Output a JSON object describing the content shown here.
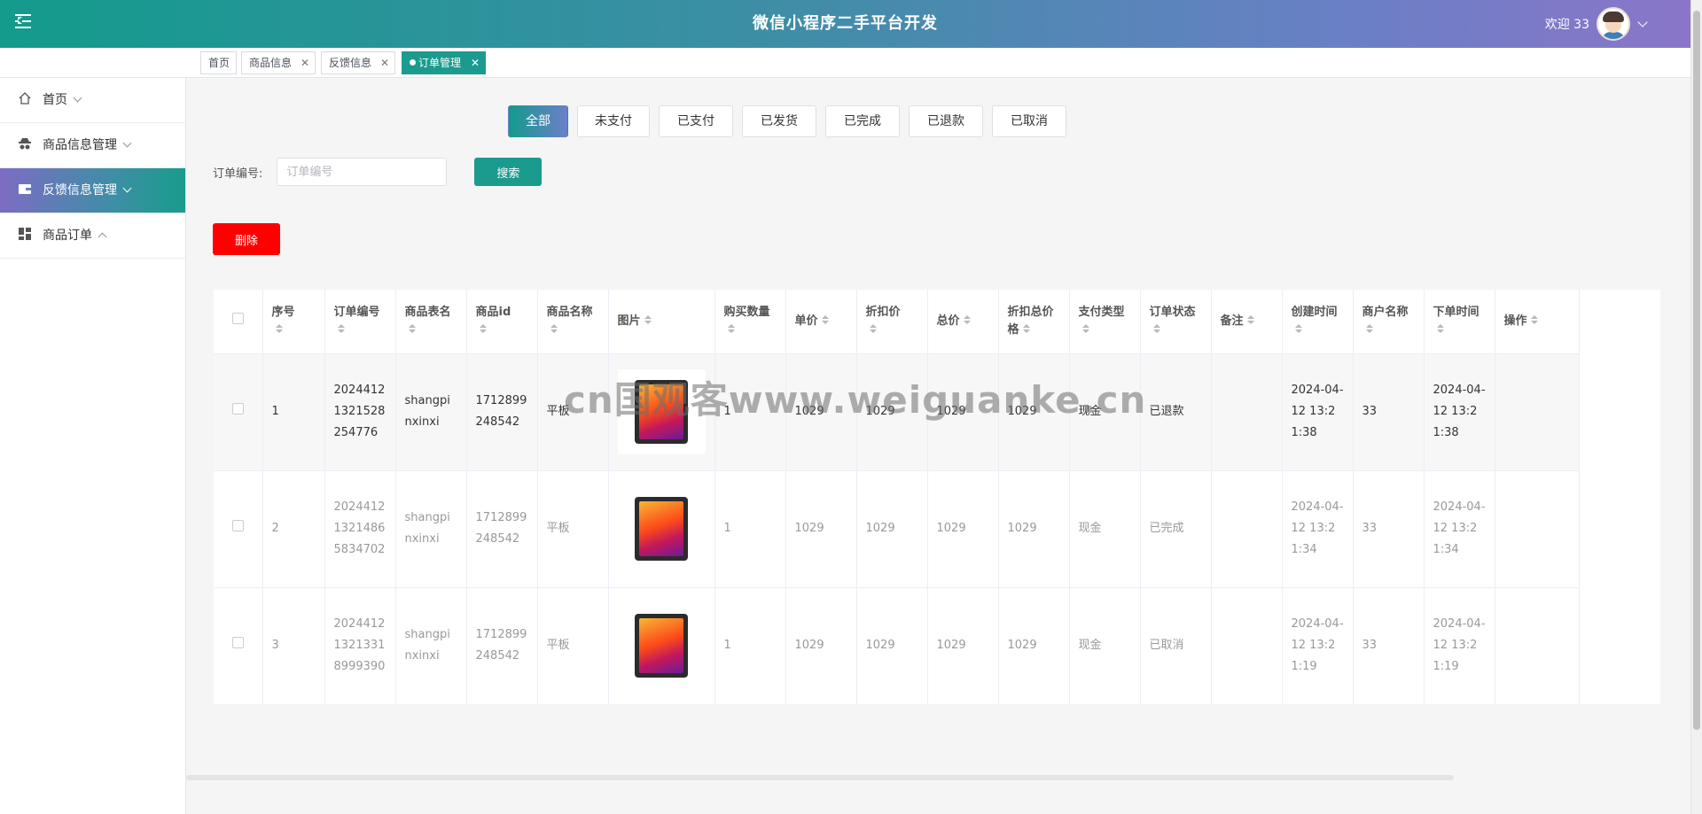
{
  "header": {
    "title": "微信小程序二手平台开发",
    "welcome": "欢迎 33"
  },
  "tags": [
    {
      "label": "首页"
    },
    {
      "label": "商品信息"
    },
    {
      "label": "反馈信息"
    },
    {
      "label": "订单管理"
    }
  ],
  "sidebar": {
    "items": [
      {
        "label": "首页"
      },
      {
        "label": "商品信息管理"
      },
      {
        "label": "反馈信息管理"
      },
      {
        "label": "商品订单"
      }
    ]
  },
  "status_tabs": [
    "全部",
    "未支付",
    "已支付",
    "已发货",
    "已完成",
    "已退款",
    "已取消"
  ],
  "search": {
    "label": "订单编号:",
    "placeholder": "订单编号",
    "button": "搜索"
  },
  "delete_label": "删除",
  "table": {
    "columns": [
      "序号",
      "订单编号",
      "商品表名",
      "商品id",
      "商品名称",
      "图片",
      "购买数量",
      "单价",
      "折扣价",
      "总价",
      "折扣总价格",
      "支付类型",
      "订单状态",
      "备注",
      "创建时间",
      "商户名称",
      "下单时间",
      "操作"
    ],
    "rows": [
      {
        "index": "1",
        "order_no": "20244121321528254776",
        "table_name": "shangpinxinxi",
        "product_id": "1712899248542",
        "product_name": "平板",
        "qty": "1",
        "price": "1029",
        "discount": "1029",
        "total": "1029",
        "discount_total": "1029",
        "pay_type": "现金",
        "status": "已退款",
        "remark": "",
        "created": "2024-04-12 13:21:38",
        "merchant": "33",
        "order_time": "2024-04-12 13:21:38"
      },
      {
        "index": "2",
        "order_no": "20244121321486583470​2",
        "table_name": "shangpinxinxi",
        "product_id": "1712899248542",
        "product_name": "平板",
        "qty": "1",
        "price": "1029",
        "discount": "1029",
        "total": "1029",
        "discount_total": "1029",
        "pay_type": "现金",
        "status": "已完成",
        "remark": "",
        "created": "2024-04-12 13:21:34",
        "merchant": "33",
        "order_time": "2024-04-12 13:21:34"
      },
      {
        "index": "3",
        "order_no": "20244121321331899939​0",
        "table_name": "shangpinxinxi",
        "product_id": "1712899248542",
        "product_name": "平板",
        "qty": "1",
        "price": "1029",
        "discount": "1029",
        "total": "1029",
        "discount_total": "1029",
        "pay_type": "现金",
        "status": "已取消",
        "remark": "",
        "created": "2024-04-12 13:21:19",
        "merchant": "33",
        "order_time": "2024-04-12 13:21:19"
      }
    ]
  },
  "watermark": "cn国观客www.weiguanke.cn"
}
